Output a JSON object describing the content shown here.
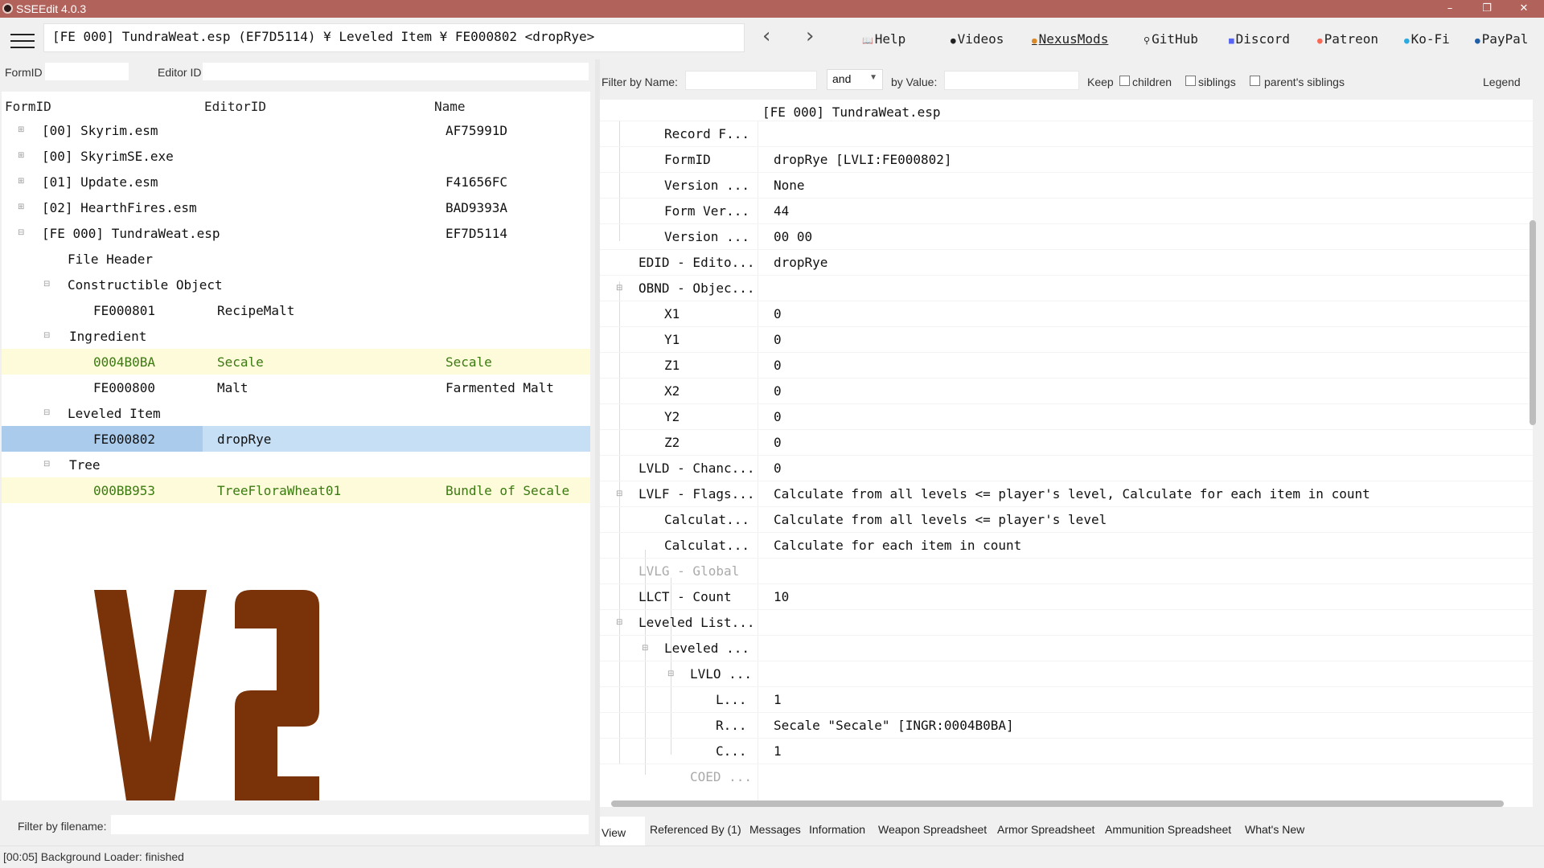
{
  "window": {
    "title": "SSEEdit 4.0.3",
    "minimize": "–",
    "maximize": "❐",
    "close": "✕"
  },
  "toolbar": {
    "path": "[FE 000] TundraWeat.esp (EF7D5114) ¥ Leveled Item ¥ FE000802 <dropRye>",
    "back": "‹",
    "forward": "›",
    "links": [
      {
        "glyph": "📖",
        "label": "Help"
      },
      {
        "glyph": "●",
        "label": "Videos"
      },
      {
        "glyph": "●",
        "label": "NexusMods"
      },
      {
        "glyph": "⚲",
        "label": "GitHub"
      },
      {
        "glyph": "■",
        "label": "Discord"
      },
      {
        "glyph": "●",
        "label": "Patreon"
      },
      {
        "glyph": "●",
        "label": "Ko-Fi"
      },
      {
        "glyph": "●",
        "label": "PayPal"
      }
    ]
  },
  "left": {
    "formid_label": "FormID",
    "editorid_label": "Editor ID",
    "columns": {
      "formid": "FormID",
      "editorid": "EditorID",
      "name": "Name"
    },
    "rows": [
      {
        "exp": "⊞",
        "formid": "[00] Skyrim.esm",
        "editorid": "",
        "name": "AF75991D"
      },
      {
        "exp": "⊞",
        "formid": "[00] SkyrimSE.exe",
        "editorid": "",
        "name": ""
      },
      {
        "exp": "⊞",
        "formid": "[01] Update.esm",
        "editorid": "",
        "name": "F41656FC"
      },
      {
        "exp": "⊞",
        "formid": "[02] HearthFires.esm",
        "editorid": "",
        "name": "BAD9393A"
      },
      {
        "exp": "⊟",
        "formid": "[FE 000] TundraWeat.esp",
        "editorid": "",
        "name": "EF7D5114"
      },
      {
        "exp": "",
        "formid": "File Header",
        "editorid": "",
        "name": ""
      },
      {
        "exp": "⊟",
        "formid": "Constructible Object",
        "editorid": "",
        "name": ""
      },
      {
        "exp": "",
        "formid": "FE000801",
        "editorid": "RecipeMalt",
        "name": ""
      },
      {
        "exp": "⊟",
        "formid": "Ingredient",
        "editorid": "",
        "name": ""
      },
      {
        "exp": "",
        "formid": "0004B0BA",
        "editorid": "Secale",
        "name": "Secale"
      },
      {
        "exp": "",
        "formid": "FE000800",
        "editorid": "Malt",
        "name": "Farmented Malt"
      },
      {
        "exp": "⊟",
        "formid": "Leveled Item",
        "editorid": "",
        "name": ""
      },
      {
        "exp": "",
        "formid": "FE000802",
        "editorid": "dropRye",
        "name": ""
      },
      {
        "exp": "⊟",
        "formid": "Tree",
        "editorid": "",
        "name": ""
      },
      {
        "exp": "",
        "formid": "000BB953",
        "editorid": "TreeFloraWheat01",
        "name": "Bundle of Secale"
      }
    ],
    "filename_label": "Filter by filename:"
  },
  "right": {
    "filter_name_label": "Filter by Name:",
    "and_value": "and",
    "by_value_label": "by Value:",
    "keep_label": "Keep",
    "children_label": "children",
    "siblings_label": "siblings",
    "parents_siblings_label": "parent's siblings",
    "legend_label": "Legend",
    "record_header": "[FE 000] TundraWeat.esp",
    "rows": [
      {
        "exp": "",
        "label": "Record F...",
        "value": ""
      },
      {
        "exp": "",
        "label": "FormID",
        "value": "dropRye [LVLI:FE000802]"
      },
      {
        "exp": "",
        "label": "Version ...",
        "value": "None"
      },
      {
        "exp": "",
        "label": "Form Ver...",
        "value": "44"
      },
      {
        "exp": "",
        "label": "Version ...",
        "value": "00 00"
      },
      {
        "exp": "",
        "label": "EDID - Edito...",
        "value": "dropRye"
      },
      {
        "exp": "⊟",
        "label": "OBND - Objec...",
        "value": ""
      },
      {
        "exp": "",
        "label": "X1",
        "value": "0"
      },
      {
        "exp": "",
        "label": "Y1",
        "value": "0"
      },
      {
        "exp": "",
        "label": "Z1",
        "value": "0"
      },
      {
        "exp": "",
        "label": "X2",
        "value": "0"
      },
      {
        "exp": "",
        "label": "Y2",
        "value": "0"
      },
      {
        "exp": "",
        "label": "Z2",
        "value": "0"
      },
      {
        "exp": "",
        "label": "LVLD - Chanc...",
        "value": "0"
      },
      {
        "exp": "⊟",
        "label": "LVLF - Flags...",
        "value": "Calculate from all levels <= player's level, Calculate for each item in count"
      },
      {
        "exp": "",
        "label": "Calculat...",
        "value": "Calculate from all levels <= player's level"
      },
      {
        "exp": "",
        "label": "Calculat...",
        "value": "Calculate for each item in count"
      },
      {
        "exp": "",
        "label": "LVLG - Global",
        "value": ""
      },
      {
        "exp": "",
        "label": "LLCT - Count",
        "value": "10"
      },
      {
        "exp": "⊟",
        "label": "Leveled List...",
        "value": ""
      },
      {
        "exp": "⊟",
        "label": "Leveled ...",
        "value": ""
      },
      {
        "exp": "⊟",
        "label": "LVLO ...",
        "value": ""
      },
      {
        "exp": "",
        "label": "L...",
        "value": "1"
      },
      {
        "exp": "",
        "label": "R...",
        "value": "Secale \"Secale\" [INGR:0004B0BA]"
      },
      {
        "exp": "",
        "label": "C...",
        "value": "1"
      },
      {
        "exp": "",
        "label": "COED ...",
        "value": ""
      }
    ],
    "tabs": [
      "View",
      "Referenced By (1)",
      "Messages",
      "Information",
      "Weapon Spreadsheet",
      "Armor Spreadsheet",
      "Ammunition Spreadsheet",
      "What's New"
    ]
  },
  "status": "[00:05] Background Loader: finished",
  "colors": {
    "accent_title": "#b0625b",
    "highlight_row": "#fdfbd9",
    "selected_row": "#c7dff5",
    "logo": "#7a3208"
  }
}
